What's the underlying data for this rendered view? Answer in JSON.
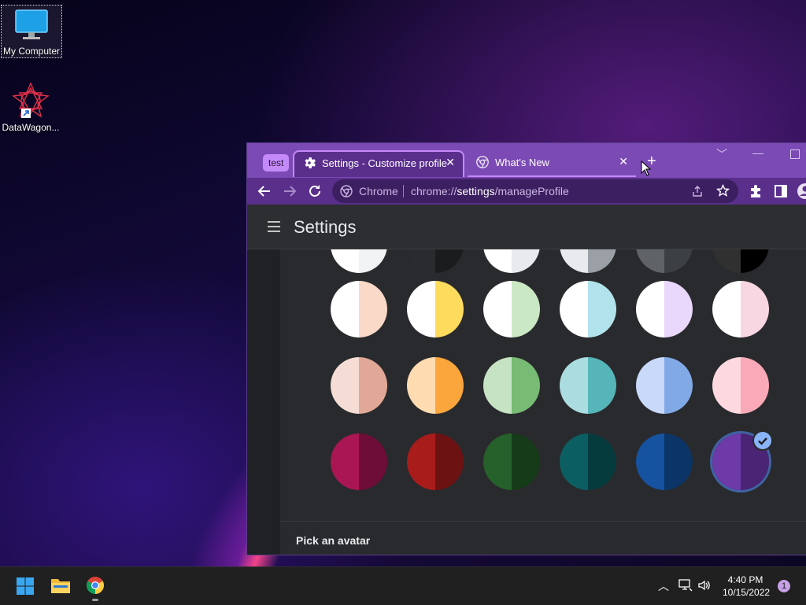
{
  "desktop": {
    "icons": [
      {
        "label": "My Computer",
        "icon": "monitor-icon"
      },
      {
        "label": "DataWagon...",
        "icon": "datawagon-icon"
      }
    ]
  },
  "browser": {
    "tab_group_label": "test",
    "tabs": [
      {
        "label": "Settings - Customize profile",
        "icon": "gear-icon",
        "active": true
      },
      {
        "label": "What's New",
        "icon": "chrome-icon",
        "active": false
      }
    ],
    "omnibox": {
      "origin": "Chrome",
      "url_prefix": "chrome://",
      "url_host": "settings",
      "url_path": "/manageProfile"
    }
  },
  "settings": {
    "title": "Settings",
    "section_label": "Pick an avatar",
    "theme_colors": [
      [
        [
          "#ffffff",
          "#f1f3f4"
        ],
        [
          "#2a2b2e",
          "#1b1c1e"
        ],
        [
          "#ffffff",
          "#e8eaed"
        ],
        [
          "#e8eaed",
          "#9aa0a6"
        ],
        [
          "#5f6368",
          "#3c4043"
        ],
        [
          "#303030",
          "#000000"
        ]
      ],
      [
        [
          "#ffffff",
          "#fad9c9"
        ],
        [
          "#ffffff",
          "#fddb5c"
        ],
        [
          "#ffffff",
          "#cbe8c4"
        ],
        [
          "#ffffff",
          "#b2e3ed"
        ],
        [
          "#ffffff",
          "#e9d7fc"
        ],
        [
          "#ffffff",
          "#f8d7e3"
        ]
      ],
      [
        [
          "#f5ddd6",
          "#e2a897"
        ],
        [
          "#fedbb0",
          "#fba53d"
        ],
        [
          "#c6e3c3",
          "#78bb74"
        ],
        [
          "#abdcdf",
          "#55b5b9"
        ],
        [
          "#c8d9f9",
          "#81a9e6"
        ],
        [
          "#fdd9df",
          "#f9a9b8"
        ]
      ],
      [
        [
          "#a91653",
          "#6e0e38"
        ],
        [
          "#a81c1c",
          "#6d1212"
        ],
        [
          "#26602a",
          "#163b19"
        ],
        [
          "#0b5f63",
          "#063b3e"
        ],
        [
          "#1552a0",
          "#0b3566"
        ],
        [
          "#6d3aa8",
          "#4a2575"
        ]
      ]
    ],
    "selected_color_index": 23
  },
  "taskbar": {
    "time": "4:40 PM",
    "date": "10/15/2022",
    "notification_count": "1"
  }
}
